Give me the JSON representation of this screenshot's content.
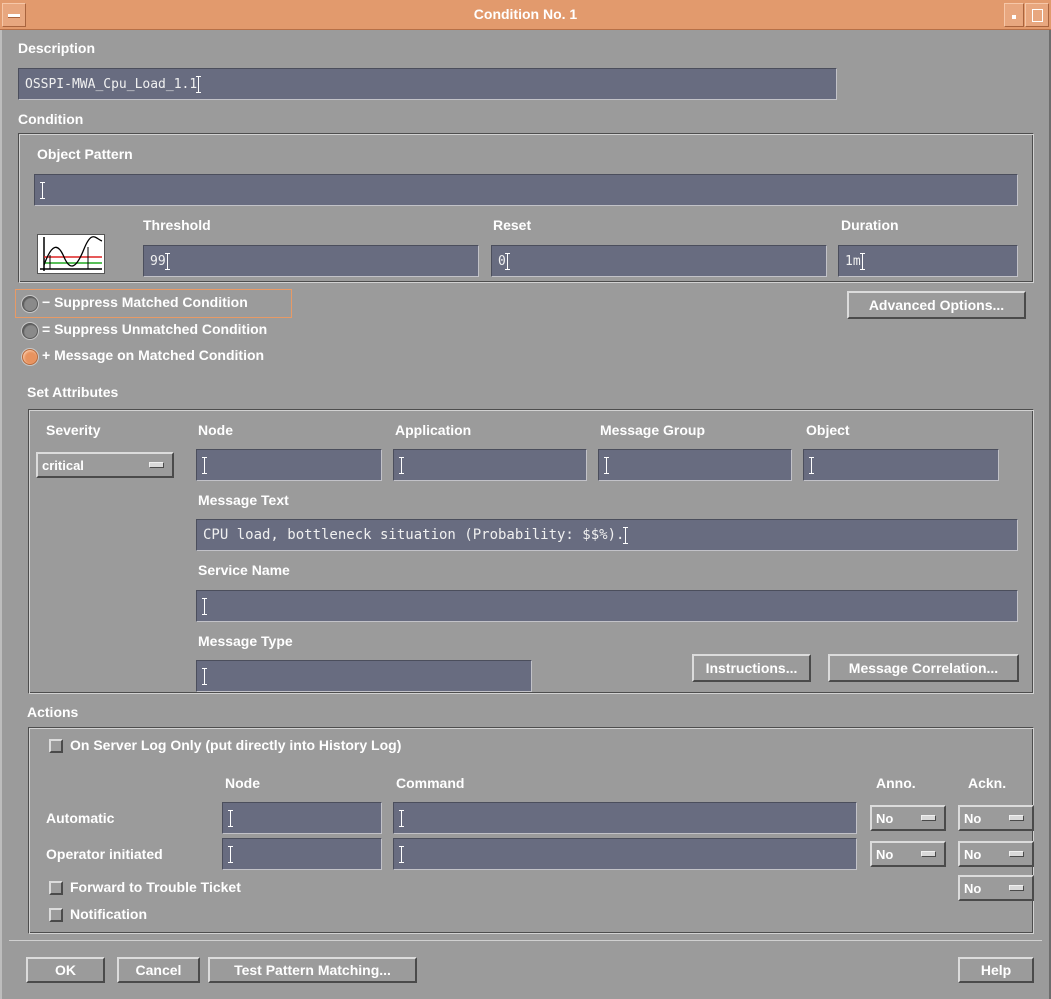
{
  "window": {
    "title": "Condition No. 1"
  },
  "description": {
    "label": "Description",
    "value": "OSSPI-MWA_Cpu_Load_1.1"
  },
  "condition": {
    "label": "Condition",
    "object_pattern_label": "Object Pattern",
    "object_pattern_value": "",
    "threshold_label": "Threshold",
    "threshold_value": "99",
    "reset_label": "Reset",
    "reset_value": "0",
    "duration_label": "Duration",
    "duration_value": "1m"
  },
  "options": {
    "suppress_matched": "− Suppress Matched Condition",
    "suppress_unmatched": "= Suppress Unmatched Condition",
    "message_on_matched": "+ Message on Matched Condition",
    "selected": "message_on_matched",
    "advanced_button": "Advanced Options..."
  },
  "set_attributes": {
    "label": "Set Attributes",
    "severity_label": "Severity",
    "severity_value": "critical",
    "node_label": "Node",
    "application_label": "Application",
    "message_group_label": "Message Group",
    "object_label": "Object",
    "message_text_label": "Message Text",
    "message_text_value": "CPU load, bottleneck situation (Probability: $$%).",
    "service_name_label": "Service Name",
    "message_type_label": "Message Type",
    "instructions_button": "Instructions...",
    "correlation_button": "Message Correlation..."
  },
  "actions": {
    "label": "Actions",
    "server_log_only": "On Server Log Only (put directly into History Log)",
    "node_label": "Node",
    "command_label": "Command",
    "anno_label": "Anno.",
    "ackn_label": "Ackn.",
    "automatic_label": "Automatic",
    "operator_label": "Operator initiated",
    "automatic_anno": "No",
    "automatic_ackn": "No",
    "operator_anno": "No",
    "operator_ackn": "No",
    "forward_label": "Forward to Trouble Ticket",
    "forward_ackn": "No",
    "notification_label": "Notification"
  },
  "footer": {
    "ok": "OK",
    "cancel": "Cancel",
    "test": "Test Pattern Matching...",
    "help": "Help"
  },
  "colors": {
    "background": "#9b9b9b",
    "titlebar": "#e29a6d",
    "field": "#686c80",
    "radio_selected": "#e8935f"
  }
}
